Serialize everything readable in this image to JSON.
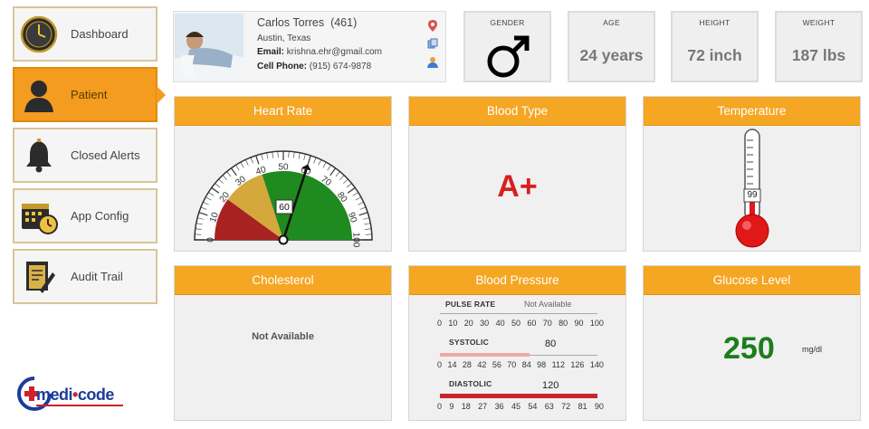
{
  "sidebar": {
    "items": [
      {
        "label": "Dashboard",
        "icon": "clock-icon",
        "active": false
      },
      {
        "label": "Patient",
        "icon": "user-icon",
        "active": true
      },
      {
        "label": "Closed Alerts",
        "icon": "bell-icon",
        "active": false
      },
      {
        "label": "App Config",
        "icon": "calendar-clock-icon",
        "active": false
      },
      {
        "label": "Audit Trail",
        "icon": "document-edit-icon",
        "active": false
      }
    ]
  },
  "logo": {
    "text_a": "medi",
    "text_b": "code"
  },
  "patient": {
    "name": "Carlos Torres",
    "id": "(461)",
    "location": "Austin, Texas",
    "email_label": "Email:",
    "email": "krishna.ehr@gmail.com",
    "phone_label": "Cell Phone:",
    "phone": "(915) 674-9878"
  },
  "stats": {
    "gender": {
      "label": "GENDER",
      "icon": "male-symbol-icon"
    },
    "age": {
      "label": "AGE",
      "value": "24 years"
    },
    "height": {
      "label": "HEIGHT",
      "value": "72 inch"
    },
    "weight": {
      "label": "WEIGHT",
      "value": "187 lbs"
    }
  },
  "panels": {
    "heart_rate": {
      "title": "Heart Rate",
      "value": "60",
      "gauge_ticks": [
        "0",
        "10",
        "20",
        "30",
        "40",
        "50",
        "60",
        "70",
        "80",
        "90",
        "100"
      ]
    },
    "blood_type": {
      "title": "Blood Type",
      "value": "A+"
    },
    "temperature": {
      "title": "Temperature",
      "value": "99"
    },
    "cholesterol": {
      "title": "Cholesterol",
      "value": "Not Available"
    },
    "blood_pressure": {
      "title": "Blood Pressure",
      "pulse_label": "PULSE RATE",
      "pulse_value": "Not Available",
      "pulse_scale": [
        "0",
        "10",
        "20",
        "30",
        "40",
        "50",
        "60",
        "70",
        "80",
        "90",
        "100"
      ],
      "systolic_label": "SYSTOLIC",
      "systolic_value": "80",
      "systolic_scale": [
        "0",
        "14",
        "28",
        "42",
        "56",
        "70",
        "84",
        "98",
        "112",
        "126",
        "140"
      ],
      "diastolic_label": "DIASTOLIC",
      "diastolic_value": "120",
      "diastolic_scale": [
        "0",
        "9",
        "18",
        "27",
        "36",
        "45",
        "54",
        "63",
        "72",
        "81",
        "90"
      ]
    },
    "glucose": {
      "title": "Glucose Level",
      "value": "250",
      "unit": "mg/dl"
    }
  },
  "colors": {
    "accent": "#f5a623",
    "active_nav": "#f39c1f",
    "blood_type": "#d81f1f",
    "glucose": "#1c7d1c",
    "gauge_green": "#1f8a1f",
    "gauge_yellow": "#d4a83a",
    "gauge_red": "#a82222"
  }
}
